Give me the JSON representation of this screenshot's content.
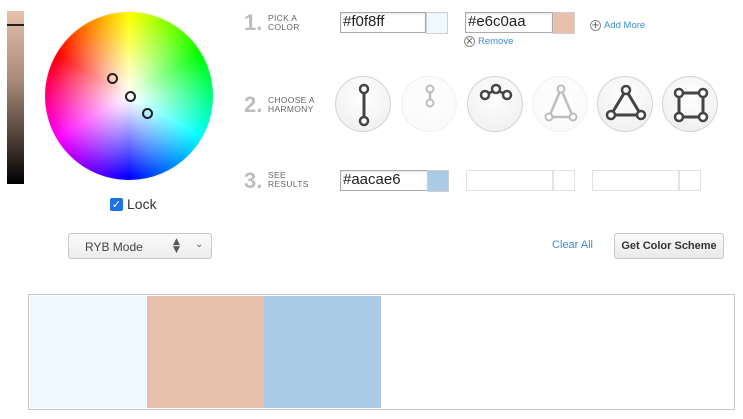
{
  "colors": {
    "primary": "#f0f8ff",
    "secondary": "#e6c0aa",
    "result": "#aacae6",
    "link": "#3a8fd6"
  },
  "lock": {
    "label": "Lock",
    "checked": true
  },
  "mode": {
    "selected": "RYB Mode"
  },
  "step1": {
    "number": "1.",
    "label_line1": "PICK A",
    "label_line2": "COLOR",
    "color1_value": "#f0f8ff",
    "color2_value": "#e6c0aa",
    "add_more_label": "Add More",
    "remove_label": "Remove"
  },
  "step2": {
    "number": "2.",
    "label_line1": "CHOOSE A",
    "label_line2": "HARMONY",
    "harmonies": [
      {
        "name": "complementary",
        "enabled": true
      },
      {
        "name": "split-complementary",
        "enabled": false
      },
      {
        "name": "analogous",
        "enabled": true
      },
      {
        "name": "triad",
        "enabled": false
      },
      {
        "name": "triad-selected",
        "enabled": true
      },
      {
        "name": "tetrad",
        "enabled": true
      }
    ]
  },
  "step3": {
    "number": "3.",
    "label_line1": "SEE",
    "label_line2": "RESULTS",
    "result_value": "#aacae6"
  },
  "actions": {
    "clear_all": "Clear All",
    "get_scheme": "Get Color Scheme"
  },
  "palette": [
    "#f0f8ff",
    "#e6c0aa",
    "#aacae6"
  ]
}
